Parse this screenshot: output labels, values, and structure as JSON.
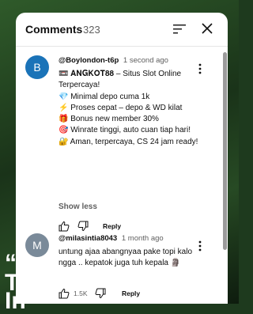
{
  "background": {
    "line1": "“f",
    "line2": "T",
    "line3": "In"
  },
  "header": {
    "title": "Comments",
    "count": "323"
  },
  "comments": [
    {
      "avatar_letter": "B",
      "avatar_color": "#1a73b8",
      "author": "@Boylondon-t6p",
      "time": "1 second ago",
      "body": "📼 𝐀𝐍𝐆𝐊𝐎𝐓𝟖𝟖 – Situs Slot Online Terpercaya!\n💎 Minimal depo cuma 1k\n⚡ Proses cepat – depo & WD kilat\n🎁 Bonus new member 30%\n🎯 Winrate tinggi, auto cuan tiap hari!\n🔐 Aman, terpercaya, CS 24 jam ready!",
      "show_less": "Show less",
      "reply": "Reply"
    },
    {
      "avatar_letter": "M",
      "avatar_color": "#7a8a99",
      "author": "@milasintia8043",
      "time": "1 month ago",
      "body": "untung ajaa abangnyaa pake topi kalo ngga .. kepatok juga tuh kepala 🗿",
      "likes": "1.5K",
      "reply": "Reply"
    }
  ]
}
